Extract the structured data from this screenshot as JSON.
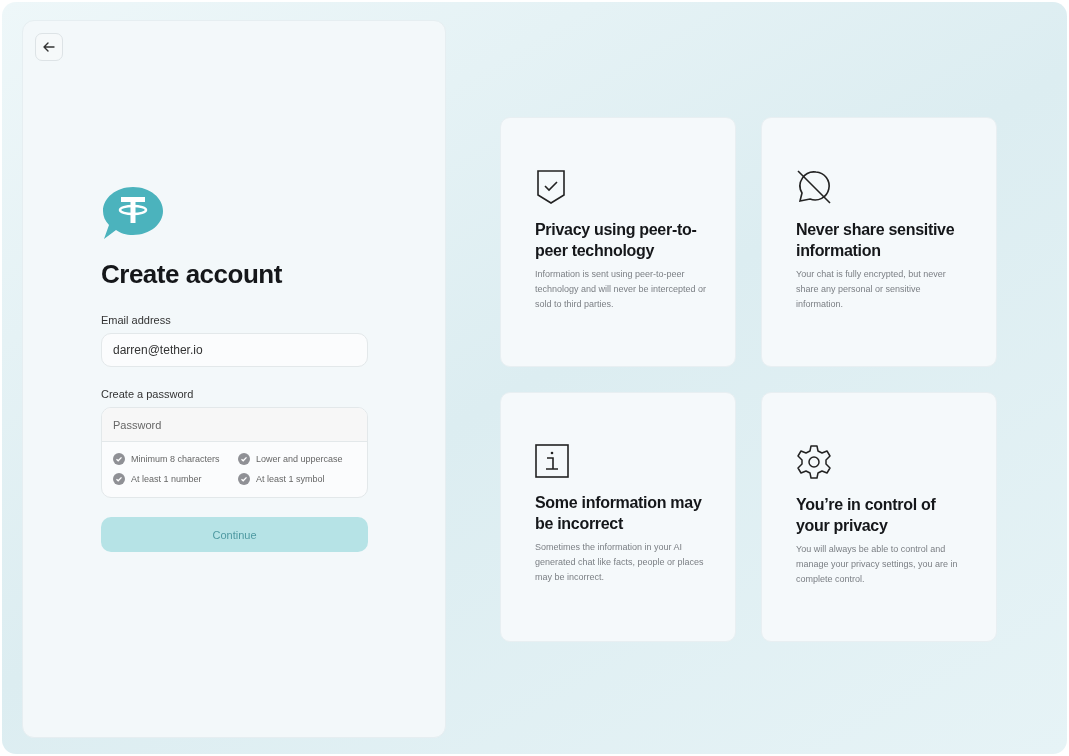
{
  "signup": {
    "title": "Create account",
    "email": {
      "label": "Email address",
      "value": "darren@tether.io"
    },
    "password": {
      "label": "Create a password",
      "placeholder": "Password"
    },
    "requirements": [
      {
        "label": "Minimum 8 characters",
        "met": false
      },
      {
        "label": "Lower and uppercase",
        "met": false
      },
      {
        "label": "At least 1 number",
        "met": false
      },
      {
        "label": "At least 1 symbol",
        "met": false
      }
    ],
    "continue_button": {
      "label": "Continue",
      "disabled": true
    }
  },
  "cards": [
    {
      "kind": "shield",
      "title": "Privacy using peer-to-peer technology",
      "text": "Information is sent using peer-to-peer technology and will never be intercepted or sold to third parties."
    },
    {
      "kind": "no-chat",
      "title": "Never share sensitive information",
      "text": "Your chat is fully encrypted, but never share any personal or sensitive information."
    },
    {
      "kind": "info",
      "title": "Some information may be incorrect",
      "text": "Sometimes the information in your AI generated chat like facts, people or places may be incorrect."
    },
    {
      "kind": "gear",
      "title": "You’re in control of your privacy",
      "text": "You will always be able to control and manage your privacy settings, you are in complete control."
    }
  ]
}
